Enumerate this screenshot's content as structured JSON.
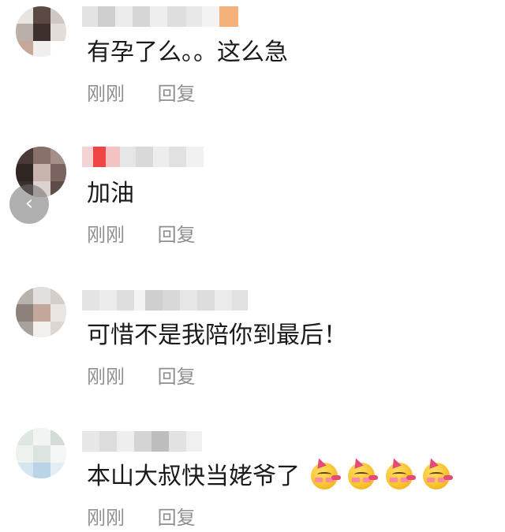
{
  "comments": [
    {
      "text": "有孕了么。。这么急",
      "time": "刚刚",
      "reply": "回复",
      "emojis": []
    },
    {
      "text": "加油",
      "time": "刚刚",
      "reply": "回复",
      "emojis": []
    },
    {
      "text": "可惜不是我陪你到最后！",
      "time": "刚刚",
      "reply": "回复",
      "emojis": []
    },
    {
      "text": "本山大叔快当姥爷了",
      "time": "刚刚",
      "reply": "回复",
      "emojis": [
        "partying-face-icon",
        "partying-face-icon",
        "partying-face-icon",
        "partying-face-icon"
      ]
    }
  ],
  "back_button_icon": "chevron-left-icon",
  "colors": {
    "text": "#1a1a1a",
    "meta": "#8f8f8f",
    "background": "#ffffff"
  }
}
